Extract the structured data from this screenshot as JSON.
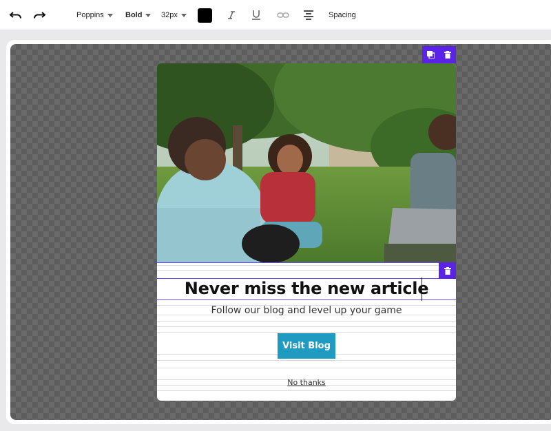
{
  "toolbar": {
    "undo_icon": "undo-icon",
    "redo_icon": "redo-icon",
    "font_family": "Poppins",
    "font_weight": "Bold",
    "font_size": "32px",
    "text_color": "#000000",
    "italic_icon": "italic-icon",
    "underline_icon": "underline-icon",
    "link_icon": "link-icon",
    "align_icon": "align-center-icon",
    "spacing_label": "Spacing"
  },
  "popup": {
    "image_alt": "Students sitting on grass",
    "headline": "Never miss the new article",
    "subtitle": "Follow our blog and level up your game",
    "cta_label": "Visit Blog",
    "cta_color": "#1f9bc2",
    "dismiss_label": "No thanks"
  },
  "selection": {
    "accent": "#5b22e8",
    "block_actions": [
      "duplicate-icon",
      "trash-icon"
    ],
    "line_actions": [
      "trash-icon"
    ]
  }
}
